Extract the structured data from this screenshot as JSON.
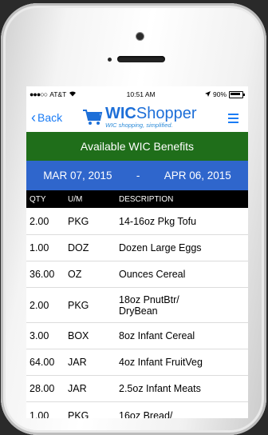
{
  "status_bar": {
    "carrier": "AT&T",
    "time": "10:51 AM",
    "battery": "90%"
  },
  "nav": {
    "back_label": "Back",
    "brand_prefix": "WIC",
    "brand_suffix": "Shopper",
    "tagline": "WIC shopping, simplified."
  },
  "header": {
    "title": "Available WIC Benefits"
  },
  "date_range": {
    "start": "MAR 07, 2015",
    "separator": "-",
    "end": "APR 06, 2015"
  },
  "table": {
    "headers": {
      "qty": "QTY",
      "um": "U/M",
      "desc": "DESCRIPTION"
    },
    "rows": [
      {
        "qty": "2.00",
        "um": "PKG",
        "desc": "14-16oz Pkg Tofu"
      },
      {
        "qty": "1.00",
        "um": "DOZ",
        "desc": "Dozen Large Eggs"
      },
      {
        "qty": "36.00",
        "um": "OZ",
        "desc": "Ounces Cereal"
      },
      {
        "qty": "2.00",
        "um": "PKG",
        "desc": "18oz PnutBtr/\nDryBean"
      },
      {
        "qty": "3.00",
        "um": "BOX",
        "desc": "8oz Infant Cereal"
      },
      {
        "qty": "64.00",
        "um": "JAR",
        "desc": "4oz Infant FruitVeg"
      },
      {
        "qty": "28.00",
        "um": "JAR",
        "desc": "2.5oz Infant Meats"
      },
      {
        "qty": "1.00",
        "um": "PKG",
        "desc": "16oz Bread/"
      }
    ]
  },
  "colors": {
    "green_header": "#1f6e1a",
    "blue_dates": "#2f66cc",
    "ios_blue": "#1a7cf5"
  }
}
